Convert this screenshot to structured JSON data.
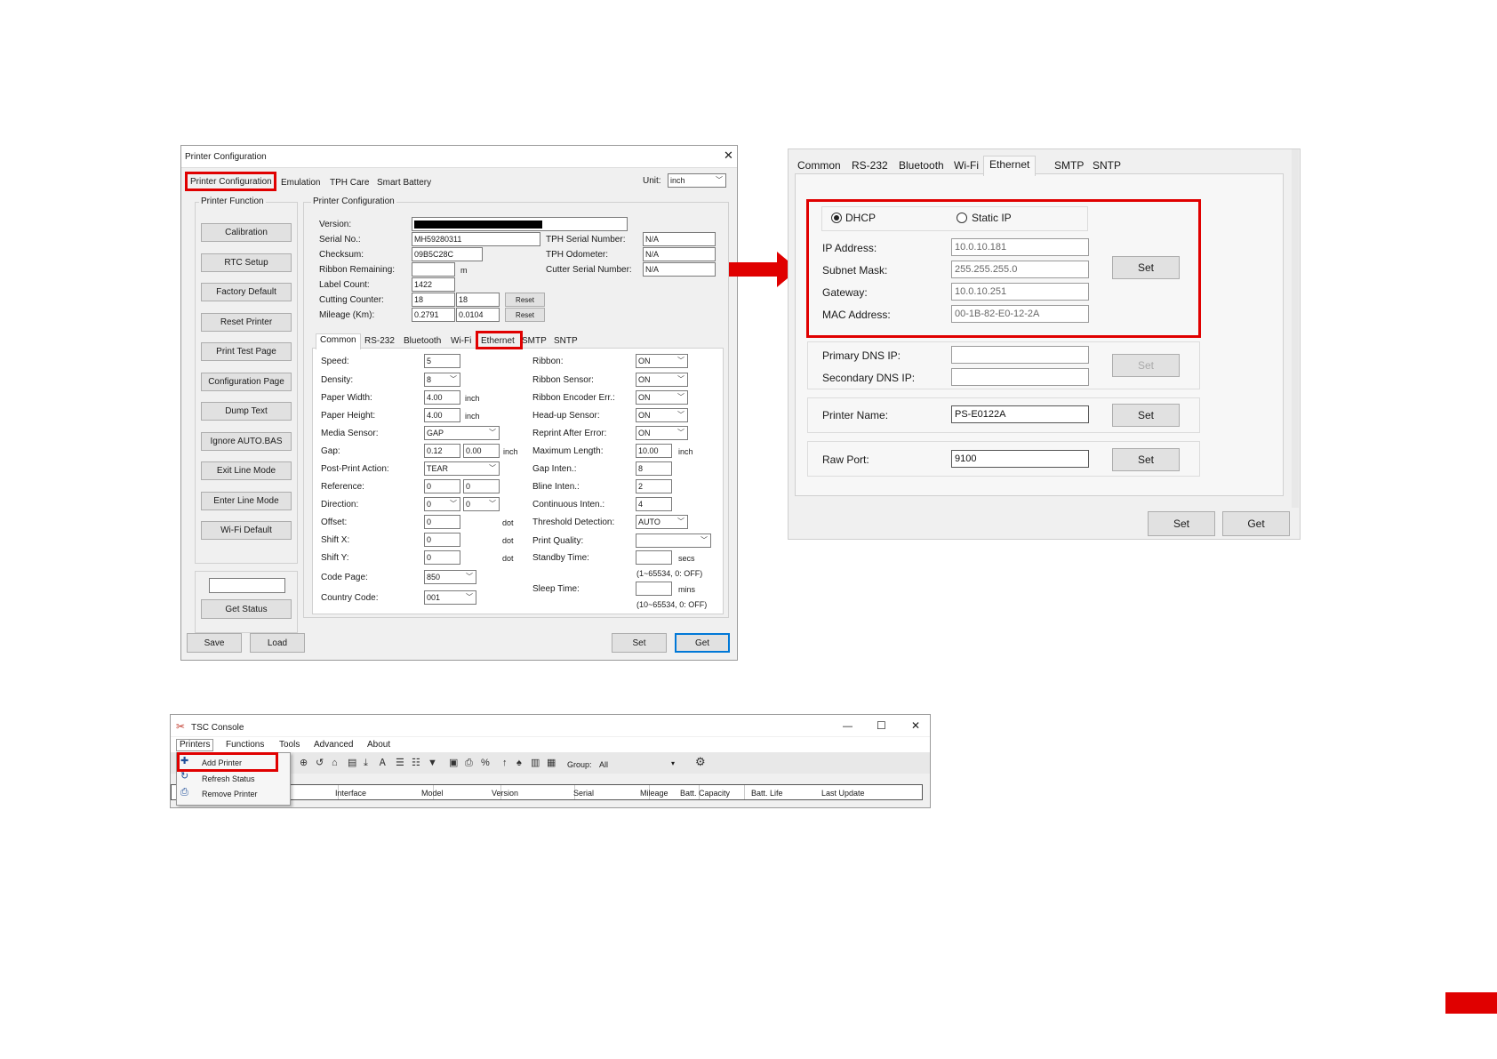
{
  "printer_config": {
    "title": "Printer Configuration",
    "close": "✕",
    "tabs": [
      "Printer Configuration",
      "Emulation",
      "TPH Care",
      "Smart Battery"
    ],
    "unit_label": "Unit:",
    "unit_value": "inch",
    "function_group": "Printer Function",
    "config_group": "Printer Configuration",
    "function_buttons": [
      "Calibration",
      "RTC Setup",
      "Factory Default",
      "Reset Printer",
      "Print Test Page",
      "Configuration Page",
      "Dump Text",
      "Ignore AUTO.BAS",
      "Exit Line Mode",
      "Enter Line Mode",
      "Wi-Fi Default"
    ],
    "get_status": "Get Status",
    "info": {
      "version_label": "Version:",
      "serial_label": "Serial No.:",
      "serial": "MH59280311",
      "checksum_label": "Checksum:",
      "checksum": "09B5C28C",
      "ribbon_label": "Ribbon Remaining:",
      "ribbon_unit": "m",
      "label_count_label": "Label Count:",
      "label_count": "1422",
      "cutting_label": "Cutting Counter:",
      "cutting_1": "18",
      "cutting_2": "18",
      "mileage_label": "Mileage (Km):",
      "mileage_1": "0.2791",
      "mileage_2": "0.0104",
      "reset": "Reset",
      "tph_serial_label": "TPH Serial Number:",
      "tph_serial": "N/A",
      "tph_odo_label": "TPH Odometer:",
      "tph_odo": "N/A",
      "cutter_serial_label": "Cutter Serial Number:",
      "cutter_serial": "N/A"
    },
    "sub_tabs": [
      "Common",
      "RS-232",
      "Bluetooth",
      "Wi-Fi",
      "Ethernet",
      "SMTP",
      "SNTP"
    ],
    "left_fields": {
      "speed_label": "Speed:",
      "speed": "5",
      "density_label": "Density:",
      "density": "8",
      "paper_width_label": "Paper Width:",
      "paper_width": "4.00",
      "inch": "inch",
      "paper_height_label": "Paper Height:",
      "paper_height": "4.00",
      "media_label": "Media Sensor:",
      "media": "GAP",
      "gap_label": "Gap:",
      "gap_1": "0.12",
      "gap_2": "0.00",
      "post_label": "Post-Print Action:",
      "post": "TEAR",
      "reference_label": "Reference:",
      "ref_1": "0",
      "ref_2": "0",
      "direction_label": "Direction:",
      "dir_1": "0",
      "dir_2": "0",
      "offset_label": "Offset:",
      "offset": "0",
      "dot": "dot",
      "shiftx_label": "Shift X:",
      "shiftx": "0",
      "shifty_label": "Shift Y:",
      "shifty": "0",
      "codepage_label": "Code Page:",
      "codepage": "850",
      "country_label": "Country Code:",
      "country": "001"
    },
    "right_fields": {
      "ribbon_label": "Ribbon:",
      "ribbon": "ON",
      "ribbon_sensor_label": "Ribbon Sensor:",
      "ribbon_sensor": "ON",
      "ribbon_enc_label": "Ribbon Encoder Err.:",
      "ribbon_enc": "ON",
      "headup_label": "Head-up Sensor:",
      "headup": "ON",
      "reprint_label": "Reprint After Error:",
      "reprint": "ON",
      "maxlen_label": "Maximum Length:",
      "maxlen": "10.00",
      "inch": "inch",
      "gap_inten_label": "Gap Inten.:",
      "gap_inten": "8",
      "bline_label": "Bline Inten.:",
      "bline": "2",
      "cont_label": "Continuous Inten.:",
      "cont": "4",
      "threshold_label": "Threshold Detection:",
      "threshold": "AUTO",
      "quality_label": "Print Quality:",
      "standby_label": "Standby Time:",
      "secs": "secs",
      "standby_range": "(1~65534, 0: OFF)",
      "sleep_label": "Sleep Time:",
      "mins": "mins",
      "sleep_range": "(10~65534, 0: OFF)"
    },
    "bottom": {
      "save": "Save",
      "load": "Load",
      "set": "Set",
      "get": "Get"
    }
  },
  "ethernet_panel": {
    "tabs": [
      "Common",
      "RS-232",
      "Bluetooth",
      "Wi-Fi",
      "Ethernet",
      "SMTP",
      "SNTP"
    ],
    "dhcp": "DHCP",
    "static_ip": "Static IP",
    "ip_label": "IP Address:",
    "ip": "10.0.10.181",
    "mask_label": "Subnet Mask:",
    "mask": "255.255.255.0",
    "gateway_label": "Gateway:",
    "gateway": "10.0.10.251",
    "mac_label": "MAC Address:",
    "mac": "00-1B-82-E0-12-2A",
    "set": "Set",
    "dns1_label": "Primary DNS IP:",
    "dns2_label": "Secondary DNS IP:",
    "name_label": "Printer Name:",
    "name": "PS-E0122A",
    "port_label": "Raw Port:",
    "port": "9100",
    "bottom_set": "Set",
    "bottom_get": "Get"
  },
  "tsc_console": {
    "title": "TSC Console",
    "controls": {
      "min": "—",
      "max": "☐",
      "close": "✕"
    },
    "menus": [
      "Printers",
      "Functions",
      "Tools",
      "Advanced",
      "About"
    ],
    "dropdown": [
      "Add Printer",
      "Refresh Status",
      "Remove Printer"
    ],
    "group_label": "Group:",
    "group_value": "All",
    "columns": [
      "Interface",
      "Model",
      "Version",
      "Serial",
      "Mileage",
      "Batt. Capacity",
      "Batt. Life",
      "Last Update"
    ]
  },
  "colors": {
    "highlight": "#e00000",
    "arrow": "#e00000"
  }
}
